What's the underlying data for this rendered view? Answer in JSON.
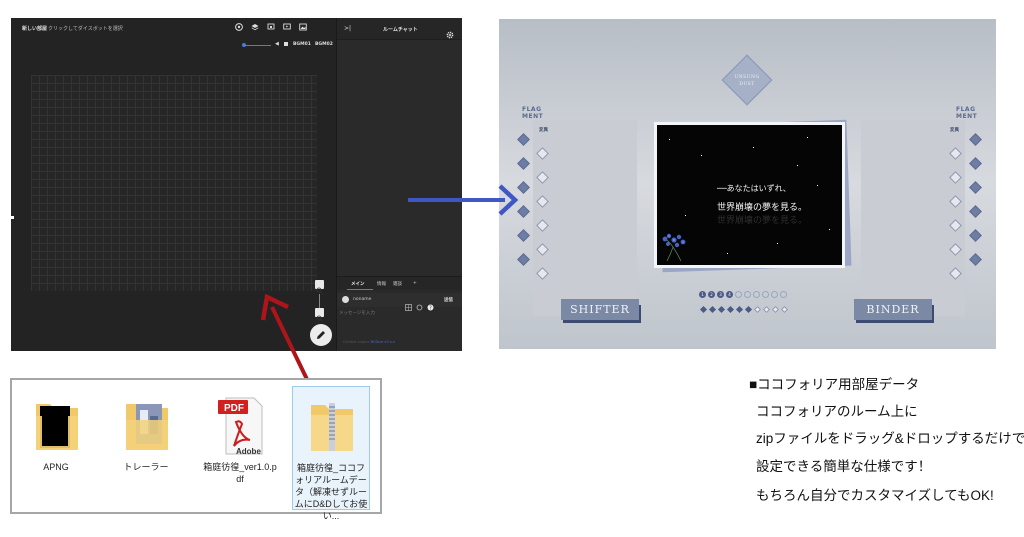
{
  "room_window": {
    "topbar": {
      "title": "新しい部屋",
      "hint": "クリックしてダイスボットを選択",
      "bgm_labels": [
        "BGM01",
        "BGM02"
      ]
    },
    "toolbar_icons": [
      "palette-icon",
      "layers-icon",
      "cards-icon",
      "screen-icon",
      "image-icon"
    ],
    "chat": {
      "collapse": ">|",
      "title": "ルームチャット",
      "tabs": [
        "メイン",
        "情報",
        "雑談",
        "+"
      ],
      "name_field": "noname",
      "send_label": "送信",
      "message_placeholder": "メッセージを入力",
      "footer_prefix": "Dicebot engine",
      "footer_link": "BCDice v3.x.x"
    }
  },
  "preview": {
    "logo_lines": [
      "UNSUNG",
      "DUST"
    ],
    "left_flag": [
      "FLAG",
      "MENT"
    ],
    "right_flag": [
      "FLAG",
      "MENT"
    ],
    "left_sub": "変異",
    "right_sub": "変異",
    "left_plate": "SHIFTER",
    "right_plate": "BINDER",
    "scene_line1": "──あなたはいずれ、",
    "scene_line2": "世界崩壊の夢を見る。",
    "scene_line3": "世界崩壊の夢を見る。",
    "pager_labels": [
      "1",
      "2",
      "3",
      "4",
      "",
      "",
      "",
      "",
      "",
      ""
    ],
    "pager_active_count": 4,
    "small_diamonds_active_count": 6,
    "small_diamonds_total": 10,
    "left_filled_diamonds": 6,
    "right_filled_diamonds": 6,
    "colors": {
      "accent": "#4b5b86",
      "arrow_blue": "#3f57c4",
      "arrow_red": "#b0141b"
    }
  },
  "explorer": {
    "files": [
      {
        "label": "APNG",
        "icon": "folder-black-icon"
      },
      {
        "label": "トレーラー",
        "icon": "folder-images-icon"
      },
      {
        "label": "箱庭彷徨_ver1.0.pdf",
        "icon": "pdf-icon",
        "badge": "PDF",
        "brand": "Adobe"
      },
      {
        "label": "箱庭彷徨_ココフォリアルームデータ（解凍せずルームにD&Dしてお使い...",
        "icon": "zip-folder-icon"
      }
    ]
  },
  "description": {
    "lines": [
      "■ココフォリア用部屋データ",
      "ココフォリアのルーム上に",
      "zipファイルをドラッグ&ドロップするだけで",
      "設定できる簡単な仕様です！",
      "もちろん自分でカスタマイズしてもOK!"
    ]
  }
}
